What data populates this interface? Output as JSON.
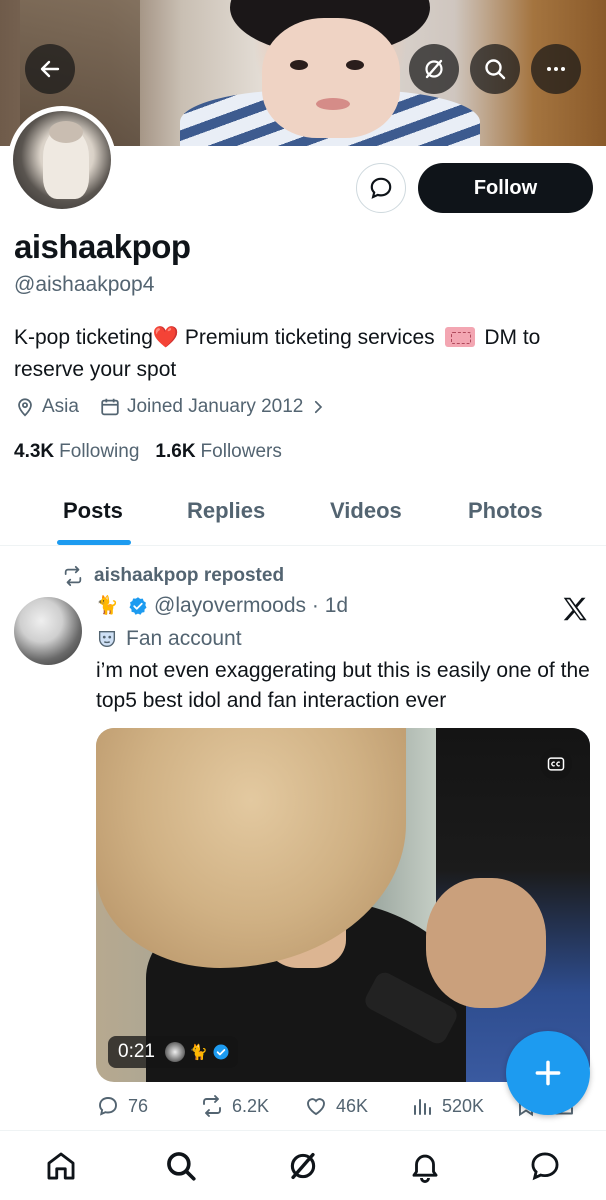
{
  "profile": {
    "name": "aishaakpop",
    "handle": "@aishaakpop4",
    "bio_part1": "K-pop ticketing",
    "bio_part2": " Premium ticketing services",
    "bio_part3": " DM to reserve your spot",
    "location": "Asia",
    "joined": "Joined January 2012",
    "following_count": "4.3K",
    "following_label": "Following",
    "followers_count": "1.6K",
    "followers_label": "Followers"
  },
  "header": {
    "back_icon": "arrow-left-icon",
    "grok_icon": "grok-icon",
    "search_icon": "search-icon",
    "more_icon": "more-horizontal-icon"
  },
  "buttons": {
    "follow_label": "Follow",
    "message_icon": "message-bubble-icon"
  },
  "tabs": [
    {
      "label": "Posts",
      "active": true
    },
    {
      "label": "Replies",
      "active": false
    },
    {
      "label": "Videos",
      "active": false
    },
    {
      "label": "Photos",
      "active": false
    }
  ],
  "post": {
    "repost_label": "aishaakpop reposted",
    "author_handle": "@layovermoods",
    "time": "· 1d",
    "author_label": "Fan account",
    "text": "i’m not even exaggerating but this is easily one of the top5 best idol and fan interaction ever",
    "video_duration": "0:21",
    "replies": "76",
    "reposts": "6.2K",
    "likes": "46K",
    "views": "520K"
  },
  "colors": {
    "accent": "#1d9bf0",
    "text_primary": "#0f1419",
    "text_secondary": "#536471",
    "heart": "#e0242f"
  },
  "bottom_nav": [
    "home-icon",
    "search-icon",
    "grok-icon",
    "notifications-icon",
    "messages-icon"
  ]
}
